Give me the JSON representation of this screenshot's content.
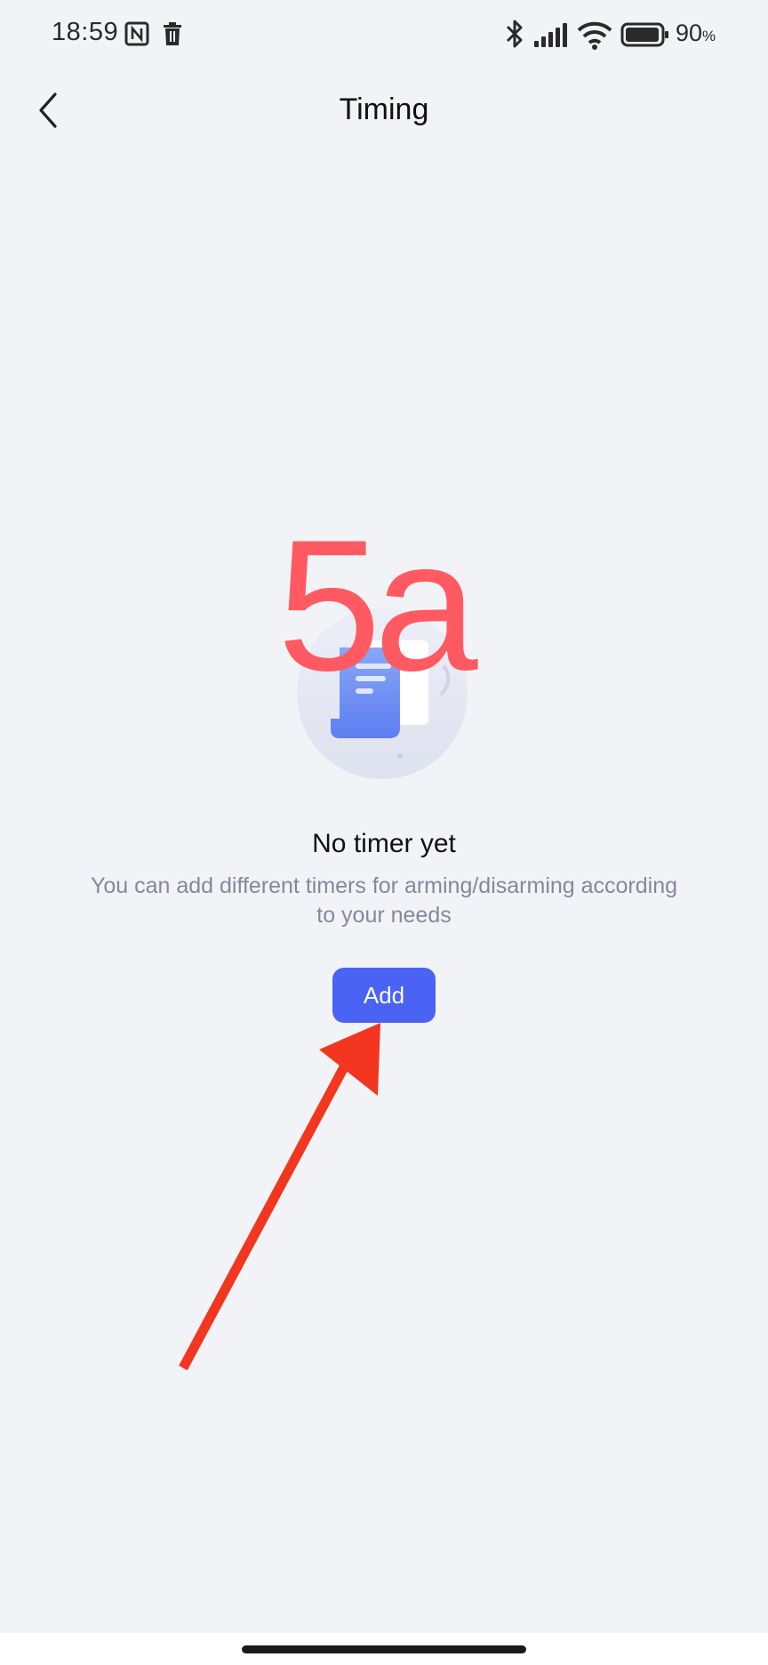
{
  "status_bar": {
    "time": "18:59",
    "battery_value": "90",
    "battery_unit": "%"
  },
  "header": {
    "title": "Timing"
  },
  "overlay_label": "5a",
  "empty_state": {
    "title": "No timer yet",
    "description": "You can add different timers for arming/disarming according to your needs",
    "add_label": "Add"
  },
  "colors": {
    "background": "#f2f3f7",
    "accent": "#4a63f5",
    "annotation_red": "#ff5a62",
    "arrow_red": "#f2361f"
  },
  "icons": [
    "nfc-icon",
    "trash-icon",
    "bluetooth-icon",
    "signal-icon",
    "wifi-icon",
    "battery-icon",
    "back-arrow-icon",
    "timer-document-illustration"
  ]
}
